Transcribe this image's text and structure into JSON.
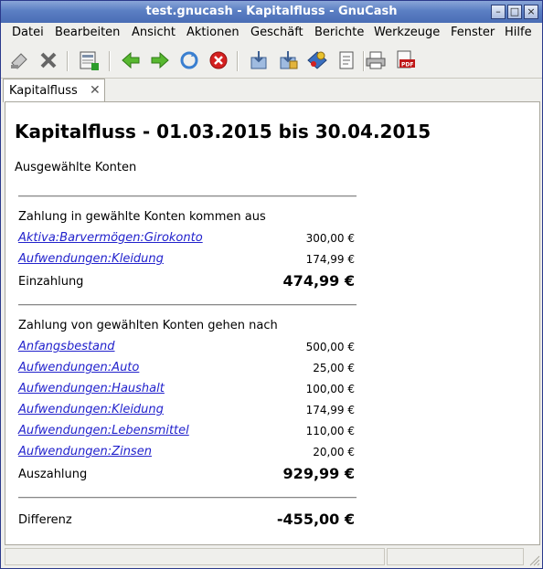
{
  "window": {
    "title": "test.gnucash - Kapitalfluss - GnuCash"
  },
  "menu": [
    "Datei",
    "Bearbeiten",
    "Ansicht",
    "Aktionen",
    "Geschäft",
    "Berichte",
    "Werkzeuge",
    "Fenster",
    "Hilfe"
  ],
  "tab": {
    "label": "Kapitalfluss",
    "close": "✕"
  },
  "report": {
    "title": "Kapitalfluss - 01.03.2015 bis 30.04.2015",
    "subtitle": "Ausgewählte Konten",
    "incoming": {
      "heading": "Zahlung in gewählte Konten kommen aus",
      "rows": [
        {
          "account": "Aktiva:Barvermögen:Girokonto",
          "amount": "300,00 €"
        },
        {
          "account": "Aufwendungen:Kleidung",
          "amount": "174,99 €"
        }
      ],
      "total_label": "Einzahlung",
      "total": "474,99 €"
    },
    "outgoing": {
      "heading": "Zahlung von gewählten Konten gehen nach",
      "rows": [
        {
          "account": "Anfangsbestand",
          "amount": "500,00 €"
        },
        {
          "account": "Aufwendungen:Auto",
          "amount": "25,00 €"
        },
        {
          "account": "Aufwendungen:Haushalt",
          "amount": "100,00 €"
        },
        {
          "account": "Aufwendungen:Kleidung",
          "amount": "174,99 €"
        },
        {
          "account": "Aufwendungen:Lebensmittel",
          "amount": "110,00 €"
        },
        {
          "account": "Aufwendungen:Zinsen",
          "amount": "20,00 €"
        }
      ],
      "total_label": "Auszahlung",
      "total": "929,99 €"
    },
    "difference_label": "Differenz",
    "difference": "-455,00 €"
  }
}
